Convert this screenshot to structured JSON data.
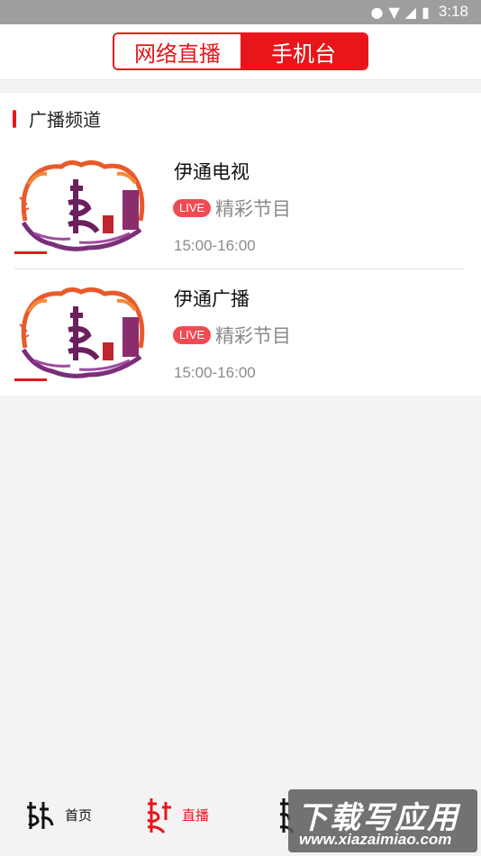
{
  "statusbar": {
    "time": "3:18"
  },
  "header": {
    "tab_network": "网络直播",
    "tab_phone": "手机台"
  },
  "section": {
    "title": "广播频道"
  },
  "channels": [
    {
      "name": "伊通电视",
      "live": "LIVE",
      "program": "精彩节目",
      "time": "15:00-16:00"
    },
    {
      "name": "伊通广播",
      "live": "LIVE",
      "program": "精彩节目",
      "time": "15:00-16:00"
    }
  ],
  "tabbar": {
    "home": "首页",
    "live": "直播",
    "third": ""
  },
  "watermark": {
    "title": "下载写应用",
    "url": "www.xiazaimiao.com"
  },
  "colors": {
    "accent": "#e8161b",
    "live_badge": "#f04b52",
    "muted": "#8a8a8a"
  }
}
